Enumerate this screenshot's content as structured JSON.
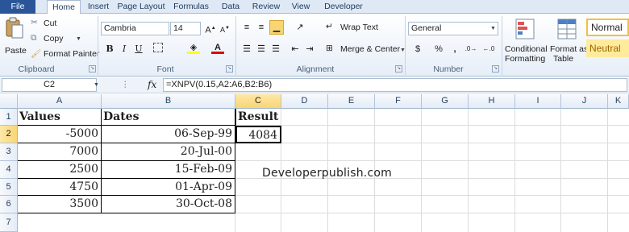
{
  "tabs": [
    "File",
    "Home",
    "Insert",
    "Page Layout",
    "Formulas",
    "Data",
    "Review",
    "View",
    "Developer"
  ],
  "ribbon": {
    "clipboard": {
      "paste": "Paste",
      "cut": "Cut",
      "copy": "Copy",
      "format_painter": "Format Painter",
      "label": "Clipboard"
    },
    "font": {
      "name": "Cambria",
      "size": "14",
      "bold": "B",
      "italic": "I",
      "underline": "U",
      "label": "Font"
    },
    "alignment": {
      "wrap_text": "Wrap Text",
      "merge_center": "Merge & Center",
      "label": "Alignment"
    },
    "number": {
      "format": "General",
      "currency": "$",
      "percent": "%",
      "comma": ",",
      "label": "Number"
    },
    "styles": {
      "conditional_1": "Conditional",
      "conditional_2": "Formatting",
      "format_as_1": "Format as",
      "format_as_2": "Table",
      "normal": "Normal",
      "neutral": "Neutral"
    }
  },
  "formula_bar": {
    "name_box": "C2",
    "fx": "fx",
    "formula": "=XNPV(0.15,A2:A6,B2:B6)"
  },
  "columns": [
    "A",
    "B",
    "C",
    "D",
    "E",
    "F",
    "G",
    "H",
    "I",
    "J",
    "K"
  ],
  "rows": [
    "1",
    "2",
    "3",
    "4",
    "5",
    "6",
    "7"
  ],
  "cells": {
    "A1": "Values",
    "B1": "Dates",
    "C1": "Result",
    "A2": "-5000",
    "B2": "06-Sep-99",
    "C2": "4084",
    "A3": "7000",
    "B3": "20-Jul-00",
    "A4": "2500",
    "B4": "15-Feb-09",
    "A5": "4750",
    "B5": "01-Apr-09",
    "A6": "3500",
    "B6": "30-Oct-08"
  },
  "watermark": "Developerpublish.com",
  "colors": {
    "file_tab": "#2a5699",
    "selected_header": "#f9d573",
    "normal_style_border": "#f0c040",
    "neutral_style_bg": "#ffeb9c"
  }
}
